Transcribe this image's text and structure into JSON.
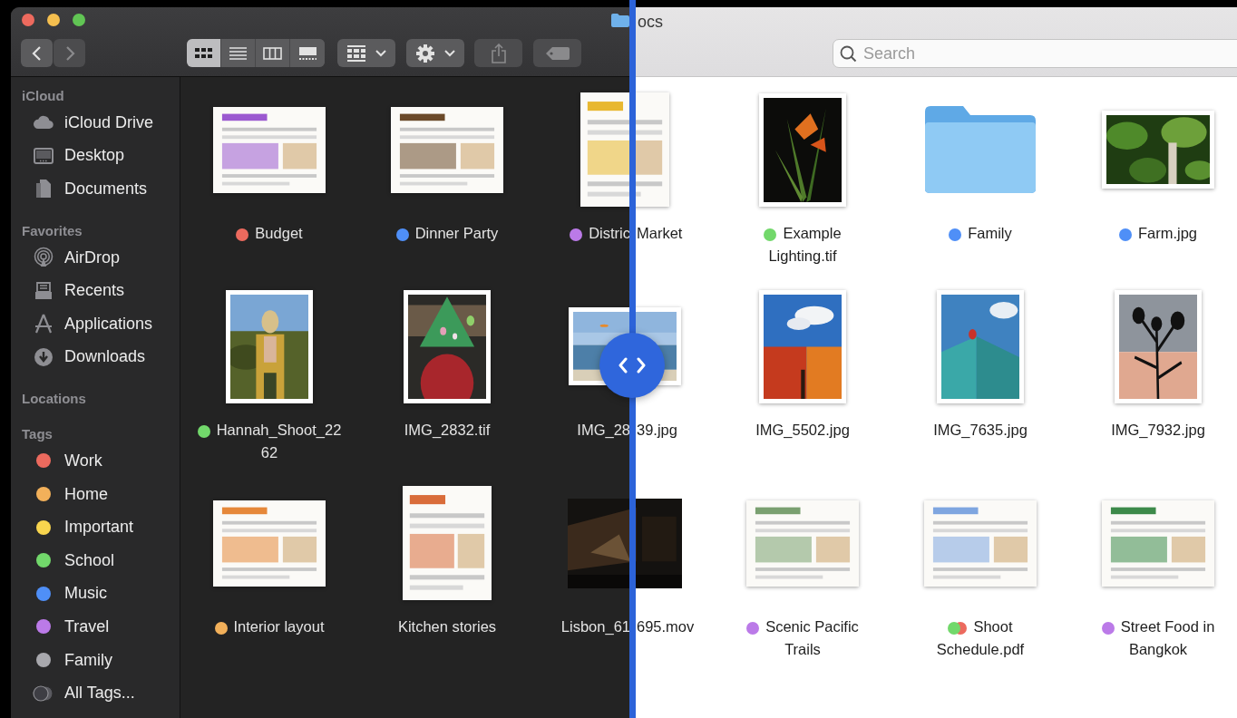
{
  "window": {
    "title": "ocs"
  },
  "left_pane": {
    "toolbar": {
      "navigation": [
        {
          "disabled": false
        },
        {
          "disabled": true
        }
      ],
      "view_modes": [
        {
          "selected": true
        },
        {
          "selected": false
        },
        {
          "selected": false
        },
        {
          "selected": false
        }
      ],
      "share": {
        "disabled": true
      },
      "tag": {
        "disabled": true
      }
    },
    "sidebar": {
      "sections": [
        {
          "title": "iCloud",
          "items": [
            {
              "label": "iCloud Drive"
            },
            {
              "label": "Desktop"
            },
            {
              "label": "Documents"
            }
          ]
        },
        {
          "title": "Favorites",
          "items": [
            {
              "label": "AirDrop"
            },
            {
              "label": "Recents"
            },
            {
              "label": "Applications"
            },
            {
              "label": "Downloads"
            }
          ]
        },
        {
          "title": "Locations"
        },
        {
          "title": "Tags",
          "items": [
            {
              "kind": "tag",
              "label": "Work",
              "color": "#ec6a5e"
            },
            {
              "kind": "tag",
              "label": "Home",
              "color": "#f2b05a"
            },
            {
              "kind": "tag",
              "label": "Important",
              "color": "#f8d54e"
            },
            {
              "kind": "tag",
              "label": "School",
              "color": "#72d86b"
            },
            {
              "kind": "tag",
              "label": "Music",
              "color": "#4f8ff7"
            },
            {
              "kind": "tag",
              "label": "Travel",
              "color": "#bb7ae8"
            },
            {
              "kind": "tag",
              "label": "Family",
              "color": "#a8a8ad"
            },
            {
              "kind": "all-tags",
              "label": "All Tags..."
            }
          ]
        }
      ]
    },
    "files": [
      {
        "label": "Budget",
        "kind": "wide-document",
        "tags": [
          {
            "color": "#ec6a5e"
          }
        ]
      },
      {
        "label": "Dinner Party",
        "kind": "wide-document",
        "tags": [
          {
            "color": "#4f8ff7"
          }
        ]
      },
      {
        "label": "Distric",
        "kind": "document",
        "tags": [
          {
            "color": "#bb7ae8"
          }
        ]
      },
      {
        "label": "Hannah_Shoot_2262",
        "tags": [
          {
            "color": "#72d86b"
          }
        ]
      },
      {
        "label": "IMG_2832.tif"
      },
      {
        "label": "IMG_28",
        "kind": "wide-photo"
      },
      {
        "label": "Interior layout",
        "kind": "wide-document",
        "tags": [
          {
            "color": "#f2b05a"
          }
        ]
      },
      {
        "label": "Kitchen stories",
        "kind": "document"
      },
      {
        "label": "Lisbon_61",
        "kind": "video"
      }
    ]
  },
  "right_pane": {
    "search": {
      "placeholder": "Search"
    },
    "files": [
      {
        "label": "Market"
      },
      {
        "label": "Example Lighting.tif",
        "tags": [
          {
            "color": "#72d86b"
          }
        ]
      },
      {
        "label": "Family",
        "kind": "folder",
        "tags": [
          {
            "color": "#4f8ff7"
          }
        ]
      },
      {
        "label": "Farm.jpg",
        "kind": "wide-photo",
        "tags": [
          {
            "color": "#4f8ff7"
          }
        ]
      },
      {
        "label": "39.jpg"
      },
      {
        "label": "IMG_5502.jpg"
      },
      {
        "label": "IMG_7635.jpg"
      },
      {
        "label": "IMG_7932.jpg"
      },
      {
        "label": "695.mov"
      },
      {
        "label": "Scenic Pacific Trails",
        "kind": "wide-document",
        "tags": [
          {
            "color": "#bb7ae8"
          }
        ]
      },
      {
        "label": "Shoot Schedule.pdf",
        "kind": "wide-document",
        "tags": [
          {
            "color": "#72d86b"
          },
          {
            "color": "#ec6a5e"
          }
        ]
      },
      {
        "label": "Street Food in Bangkok",
        "kind": "wide-document",
        "tags": [
          {
            "color": "#bb7ae8"
          }
        ]
      }
    ]
  }
}
